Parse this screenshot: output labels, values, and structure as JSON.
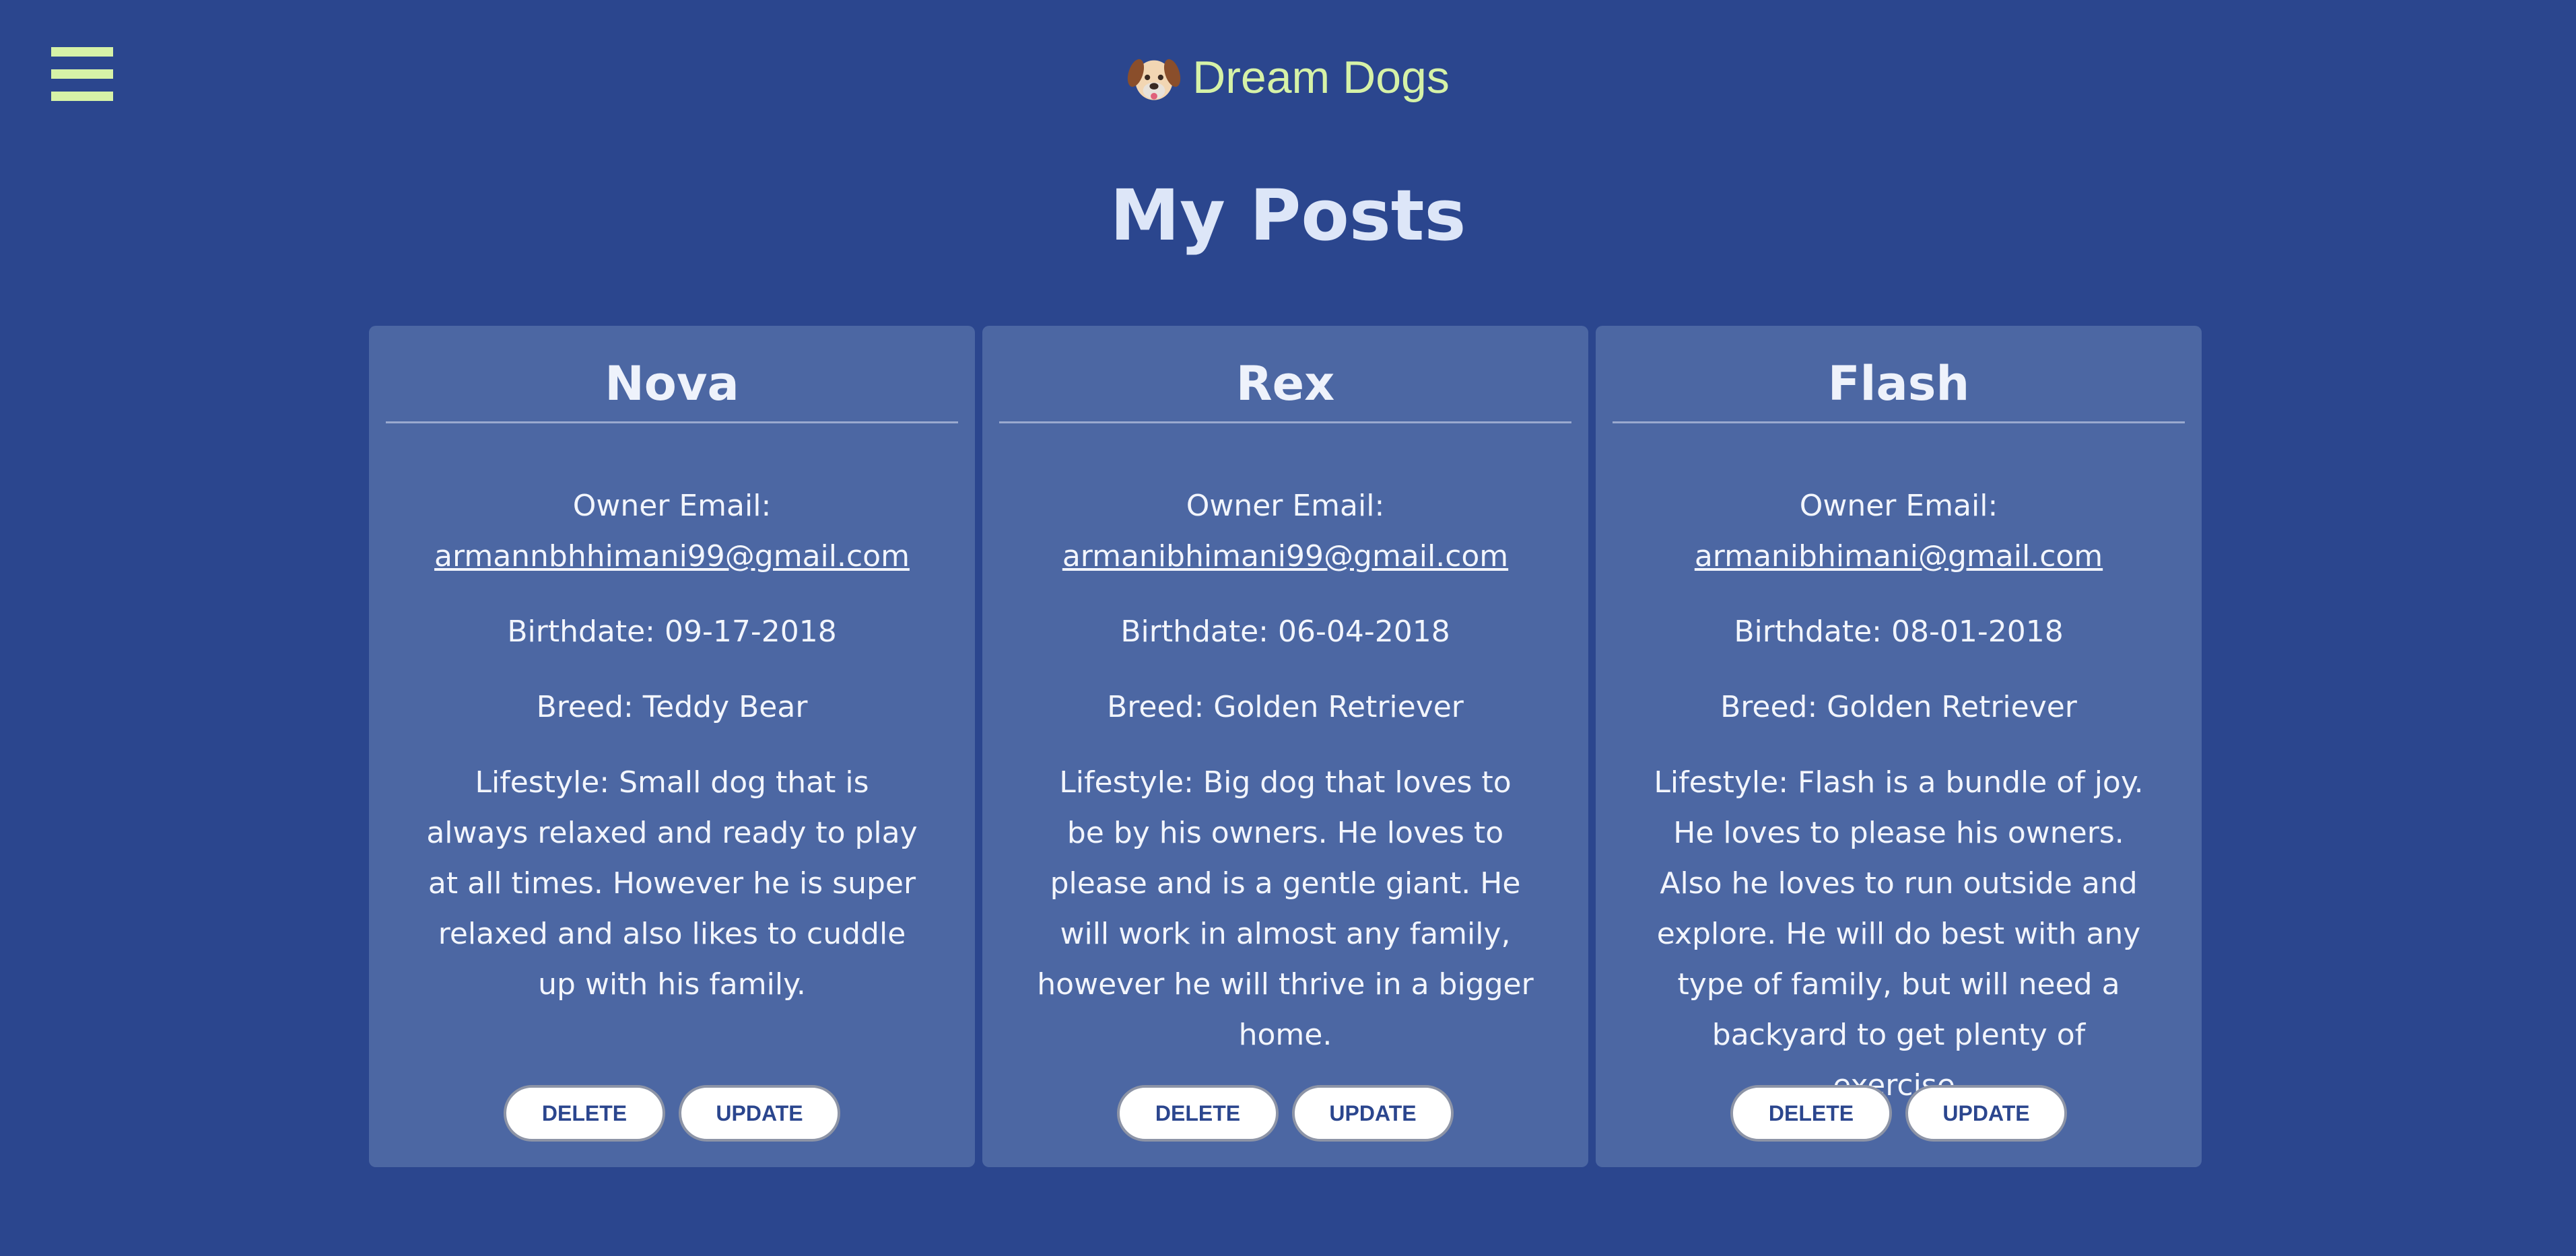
{
  "brand": {
    "title": "Dream Dogs",
    "logo_icon": "dog-face-icon",
    "accent_color": "#d6f2a7"
  },
  "nav": {
    "menu_icon": "hamburger-menu-icon"
  },
  "page": {
    "title": "My Posts",
    "background_color": "#2b468e"
  },
  "posts": [
    {
      "name": "Nova",
      "owner_label": "Owner Email:",
      "owner_email": "armannbhhimani99@gmail.com",
      "birthdate": "Birthdate: 09-17-2018",
      "breed": "Breed: Teddy Bear",
      "lifestyle": "Lifestyle: Small dog that is always relaxed and ready to play at all times. However he is super relaxed and also likes to cuddle up with his family.",
      "delete_label": "DELETE",
      "update_label": "UPDATE"
    },
    {
      "name": "Rex",
      "owner_label": "Owner Email:",
      "owner_email": "armanibhimani99@gmail.com",
      "birthdate": "Birthdate: 06-04-2018",
      "breed": "Breed: Golden Retriever",
      "lifestyle": "Lifestyle: Big dog that loves to be by his owners. He loves to please and is a gentle giant. He will work in almost any family, however he will thrive in a bigger home.",
      "delete_label": "DELETE",
      "update_label": "UPDATE"
    },
    {
      "name": "Flash",
      "owner_label": "Owner Email:",
      "owner_email": "armanibhimani@gmail.com",
      "birthdate": "Birthdate: 08-01-2018",
      "breed": "Breed: Golden Retriever",
      "lifestyle": "Lifestyle: Flash is a bundle of joy. He loves to please his owners. Also he loves to run outside and explore. He will do best with any type of family, but will need a backyard to get plenty of exercise.",
      "delete_label": "DELETE",
      "update_label": "UPDATE"
    }
  ]
}
